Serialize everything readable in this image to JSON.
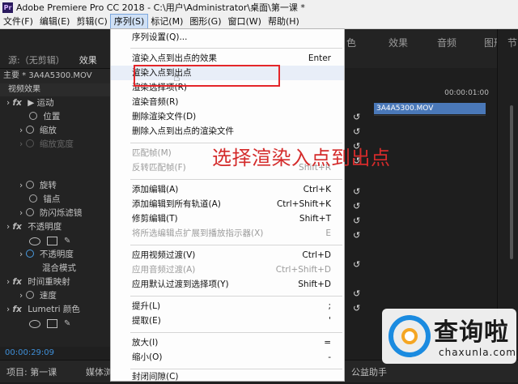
{
  "window": {
    "app_icon": "Pr",
    "title": "Adobe Premiere Pro CC 2018 - C:\\用户\\Administrator\\桌面\\第一课 *"
  },
  "menubar": [
    {
      "label": "文件(F)"
    },
    {
      "label": "编辑(E)"
    },
    {
      "label": "剪辑(C)"
    },
    {
      "label": "序列(S)"
    },
    {
      "label": "标记(M)"
    },
    {
      "label": "图形(G)"
    },
    {
      "label": "窗口(W)"
    },
    {
      "label": "帮助(H)"
    }
  ],
  "workspace_tabs": [
    "色",
    "效果",
    "音频",
    "图形"
  ],
  "far_right_tab": "节",
  "left_panel": {
    "tabs": [
      "源:（无剪辑）",
      "效果"
    ],
    "clip": "主要 * 3A4A5300.MOV",
    "section": "视频效果",
    "rows": [
      "运动",
      "位置",
      "缩放",
      "缩放宽度",
      "旋转",
      "锚点",
      "防闪烁滤镜",
      "不透明度",
      "不透明度",
      "混合模式",
      "时间重映射",
      "速度",
      "Lumetri 颜色"
    ],
    "timecode": "00:00:29:09"
  },
  "bottom_tabs": [
    "项目: 第一课",
    "媒体浏",
    "公益助手"
  ],
  "right_panel": {
    "time": "00:00:01:00",
    "clip_name": "3A4A5300.MOV"
  },
  "dropdown": {
    "items": [
      {
        "label": "序列设置(Q)...",
        "shortcut": "",
        "disabled": false
      },
      {
        "label": "渲染入点到出点的效果",
        "shortcut": "Enter",
        "disabled": false
      },
      {
        "label": "渲染入点到出点",
        "shortcut": "",
        "disabled": false
      },
      {
        "label": "渲染选择项(R)",
        "shortcut": "",
        "disabled": false
      },
      {
        "label": "渲染音频(R)",
        "shortcut": "",
        "disabled": false
      },
      {
        "label": "删除渲染文件(D)",
        "shortcut": "",
        "disabled": false
      },
      {
        "label": "删除入点到出点的渲染文件",
        "shortcut": "",
        "disabled": false
      },
      {
        "label": "匹配帧(M)",
        "shortcut": "",
        "disabled": true
      },
      {
        "label": "反转匹配帧(F)",
        "shortcut": "Shift+R",
        "disabled": true
      },
      {
        "label": "添加编辑(A)",
        "shortcut": "Ctrl+K",
        "disabled": false
      },
      {
        "label": "添加编辑到所有轨道(A)",
        "shortcut": "Ctrl+Shift+K",
        "disabled": false
      },
      {
        "label": "修剪编辑(T)",
        "shortcut": "Shift+T",
        "disabled": false
      },
      {
        "label": "将所选编辑点扩展到播放指示器(X)",
        "shortcut": "E",
        "disabled": true
      },
      {
        "label": "应用视频过渡(V)",
        "shortcut": "Ctrl+D",
        "disabled": false
      },
      {
        "label": "应用音频过渡(A)",
        "shortcut": "Ctrl+Shift+D",
        "disabled": true
      },
      {
        "label": "应用默认过渡到选择项(Y)",
        "shortcut": "Shift+D",
        "disabled": false
      },
      {
        "label": "提升(L)",
        "shortcut": ";",
        "disabled": false
      },
      {
        "label": "提取(E)",
        "shortcut": "'",
        "disabled": false
      },
      {
        "label": "放大(I)",
        "shortcut": "=",
        "disabled": false
      },
      {
        "label": "缩小(O)",
        "shortcut": "-",
        "disabled": false
      },
      {
        "label": "封闭间隙(C)",
        "shortcut": "",
        "disabled": false
      }
    ]
  },
  "annotation": "选择渲染入点到出点",
  "watermark": {
    "title": "查询啦",
    "url": "chaxunla.com"
  },
  "colors": {
    "highlight": "#e4262a",
    "annotation": "#d42b2b",
    "clip_blue": "#4a78b8",
    "timecode_blue": "#3f8fd8"
  }
}
